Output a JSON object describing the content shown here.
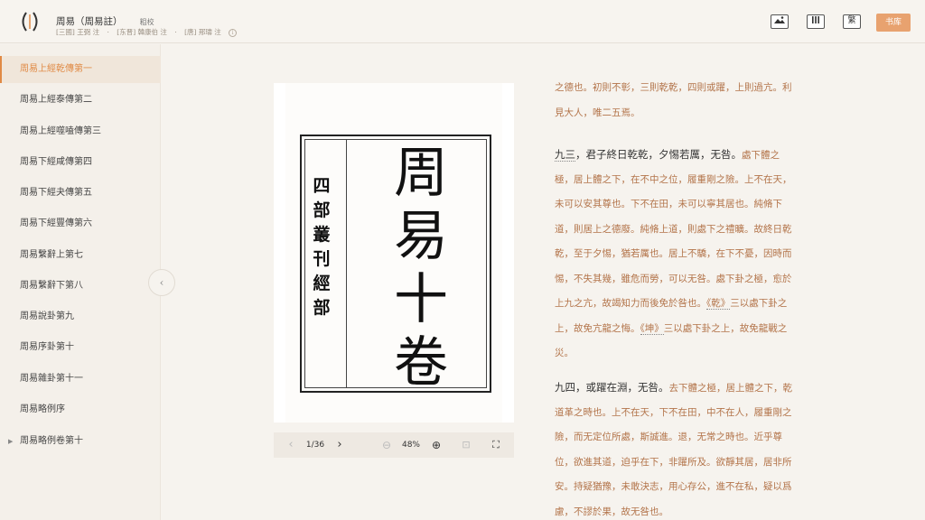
{
  "header": {
    "book_title": "周易（周易註）",
    "edition_tag": "粗校",
    "authors": [
      "[三國] 王弼 注",
      "[东晋] 韓康伯 注",
      "[唐] 邢璹 注"
    ],
    "info_icon": "ⓘ",
    "btn_image_icon": "image-view-icon",
    "btn_text_icon": "text-view-icon",
    "trad_label": "繁",
    "library_label": "书库"
  },
  "sidebar": {
    "items": [
      {
        "label": "周易上經乾傳第一"
      },
      {
        "label": "周易上經泰傳第二"
      },
      {
        "label": "周易上經噬嗑傳第三"
      },
      {
        "label": "周易下經咸傳第四"
      },
      {
        "label": "周易下經夬傳第五"
      },
      {
        "label": "周易下經豐傳第六"
      },
      {
        "label": "周易繫辭上第七"
      },
      {
        "label": "周易繫辭下第八"
      },
      {
        "label": "周易說卦第九"
      },
      {
        "label": "周易序卦第十"
      },
      {
        "label": "周易雜卦第十一"
      },
      {
        "label": "周易略例序"
      },
      {
        "label": "周易略例卷第十"
      }
    ],
    "collapse_icon": "‹"
  },
  "viewer": {
    "scan_small": "四部叢刊經部",
    "scan_big": "周易十卷",
    "prev_icon": "‹",
    "page": "1/36",
    "next_icon": "›",
    "zoom_out_icon": "⊖",
    "zoom": "48%",
    "zoom_in_icon": "⊕",
    "fit_icon": "⊡",
    "fullscreen_icon": "⛶"
  },
  "text": {
    "lines": [
      [
        "之德也。初則不彰，三則乾乾，四則或躍，上則過亢。利"
      ],
      [
        "見大人，唯二五焉。"
      ],
      [
        "九三",
        "，君子終日乾乾，夕惕若厲，无咎。",
        "處下體之"
      ],
      [
        "極，居上體之下，在不中之位，履重剛之險。上不在天，"
      ],
      [
        "未可以安其尊也。下不在田，未可以寧其居也。純脩下"
      ],
      [
        "道，則居上之德廢。純脩上道，則處下之禮曠。故終日乾"
      ],
      [
        "乾，至于夕惕，猶若厲也。居上不驕，在下不憂，因時而"
      ],
      [
        "惕，不失其幾，雖危而勞，可以无咎。處下卦之極，愈於"
      ],
      [
        "上九之亢，故竭知力而後免於咎也。",
        "《乾》",
        "三以處下卦之"
      ],
      [
        "上，故免亢龍之悔。",
        "《坤》",
        "三以處下卦之上，故免龍戰之"
      ],
      [
        "災。"
      ],
      [
        "九四，或躍在淵，无咎。",
        "去下體之極，居上體之下，乾"
      ],
      [
        "道革之時也。上不在天，下不在田，中不在人，履重剛之"
      ],
      [
        "險，而无定位所處，斯誠進。退，无常之時也。近乎尊"
      ],
      [
        "位，欲進其道，迫乎在下，非躍所及。欲靜其居，居非所"
      ],
      [
        "安。持疑猶豫，未敢決志，用心存公，進不在私，疑以爲"
      ],
      [
        "慮，不謬於果，故无咎也。"
      ]
    ]
  },
  "colors": {
    "accent": "#e08a45",
    "commentary": "#b3744a",
    "library_button": "#e8a26f"
  }
}
